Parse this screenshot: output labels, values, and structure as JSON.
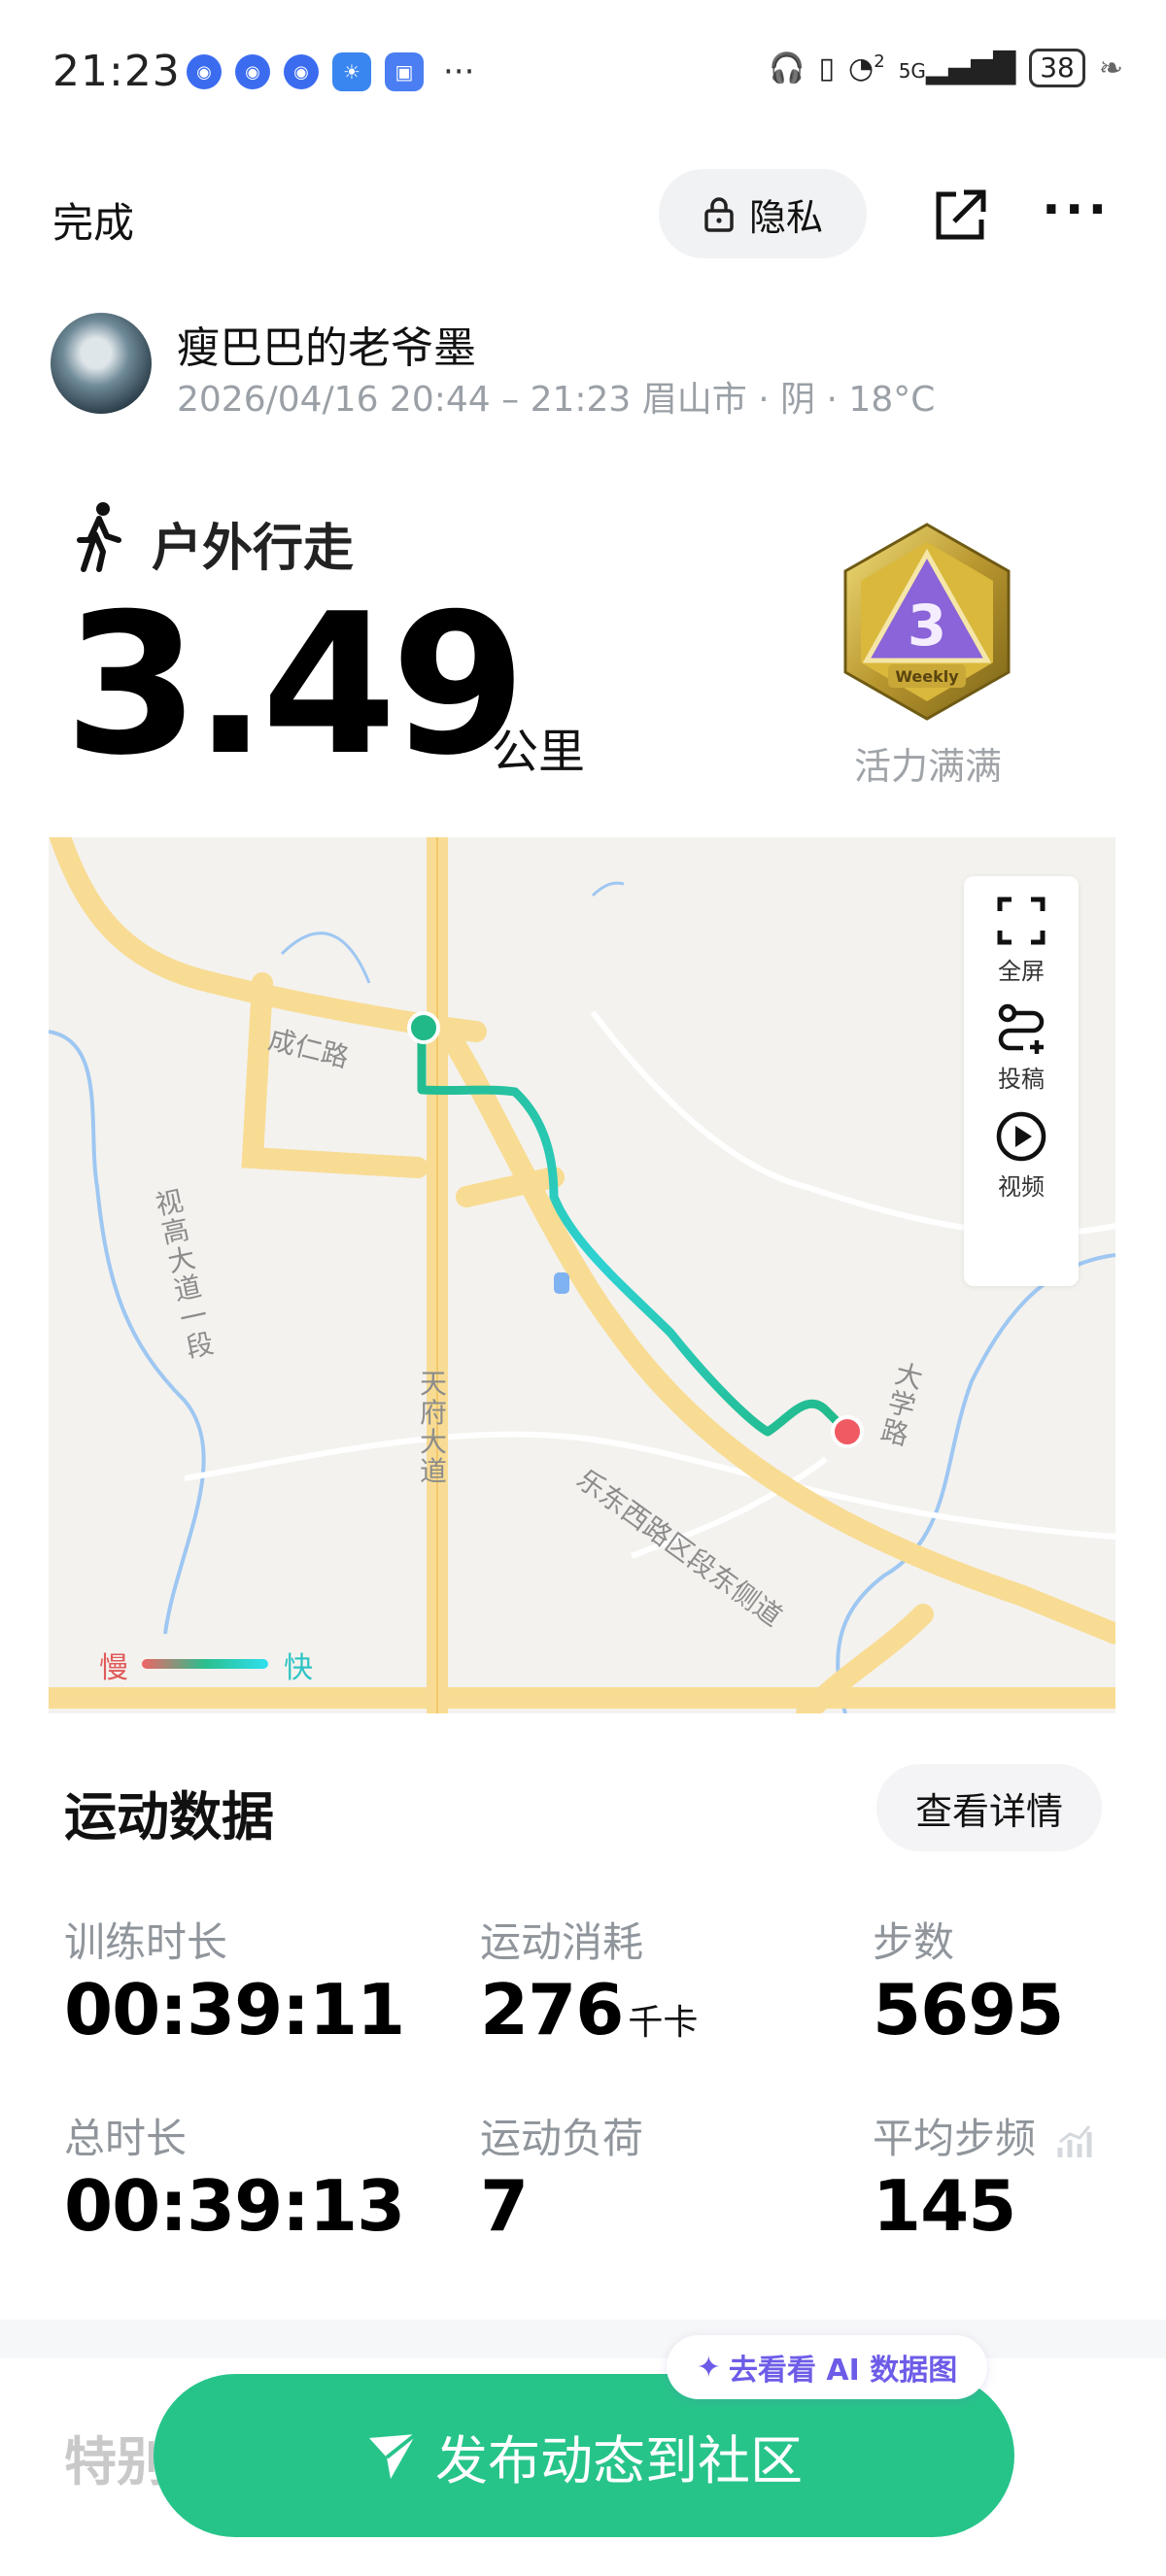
{
  "status_bar": {
    "time": "21:23",
    "battery": "38",
    "network": "5G",
    "sim_index": "2"
  },
  "header": {
    "done_label": "完成",
    "privacy_label": "隐私"
  },
  "user": {
    "name": "瘦巴巴的老爷墨",
    "session_meta": "2026/04/16 20:44 – 21:23 眉山市 · 阴 · 18°C"
  },
  "activity": {
    "type": "户外行走",
    "distance": "3.49",
    "unit": "公里",
    "medal_label": "活力满满",
    "medal_text": "Weekly"
  },
  "map": {
    "controls": [
      {
        "label": "全屏",
        "icon": "fullscreen-icon"
      },
      {
        "label": "投稿",
        "icon": "route-submit-icon"
      },
      {
        "label": "视频",
        "icon": "play-video-icon"
      }
    ],
    "legend": {
      "slow": "慢",
      "fast": "快"
    },
    "roads": [
      "成仁路",
      "视高大道一段",
      "天府大道",
      "乐东西路区段东侧道",
      "大学路"
    ],
    "colors": {
      "route_start": "#21b987",
      "route_mid": "#2fd2d2",
      "route_end": "#f05a63"
    }
  },
  "exercise_data": {
    "title": "运动数据",
    "details_label": "查看详情",
    "metrics": [
      {
        "label": "训练时长",
        "value": "00:39:11",
        "unit": ""
      },
      {
        "label": "运动消耗",
        "value": "276",
        "unit": "千卡"
      },
      {
        "label": "步数",
        "value": "5695",
        "unit": ""
      },
      {
        "label": "总时长",
        "value": "00:39:13",
        "unit": ""
      },
      {
        "label": "运动负荷",
        "value": "7",
        "unit": ""
      },
      {
        "label": "平均步频",
        "value": "145",
        "unit": ""
      }
    ]
  },
  "bottom": {
    "special_title": "特别",
    "ai_label": "去看看 AI 数据图",
    "publish_label": "发布动态到社区"
  },
  "colors": {
    "accent": "#27c48a",
    "ai_purple": "#6d5ce8"
  }
}
